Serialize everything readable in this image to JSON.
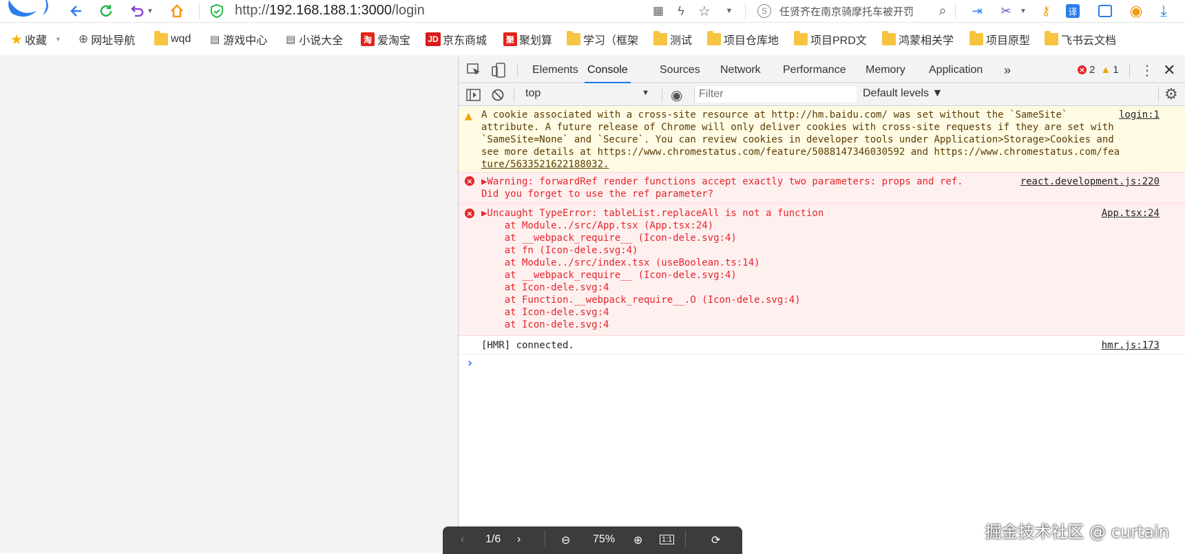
{
  "browser": {
    "url_prefix": "http://",
    "url_host": "192.168.188.1:3000",
    "url_path": "/login",
    "search_placeholder": "任贤齐在南京骑摩托车被开罚",
    "nav_icons": [
      "logo-icon",
      "back-icon",
      "refresh-icon",
      "undo-icon",
      "home-icon"
    ]
  },
  "bookmarks": [
    {
      "label": "收藏",
      "icon": "star"
    },
    {
      "label": "网址导航",
      "icon": "globe"
    },
    {
      "label": "wqd",
      "icon": "folder"
    },
    {
      "label": "游戏中心",
      "icon": "doc"
    },
    {
      "label": "小说大全",
      "icon": "doc"
    },
    {
      "label": "爱淘宝",
      "icon": "taobao",
      "badge": "淘"
    },
    {
      "label": "京东商城",
      "icon": "jd",
      "badge": "JD"
    },
    {
      "label": "聚划算",
      "icon": "jhs",
      "badge": "聚"
    },
    {
      "label": "学习（框架",
      "icon": "folder"
    },
    {
      "label": "测试",
      "icon": "folder"
    },
    {
      "label": "项目仓库地",
      "icon": "folder"
    },
    {
      "label": "项目PRD文",
      "icon": "folder"
    },
    {
      "label": "鸿蒙相关学",
      "icon": "folder"
    },
    {
      "label": "项目原型",
      "icon": "folder"
    },
    {
      "label": "飞书云文档",
      "icon": "folder"
    }
  ],
  "devtools": {
    "tabs": [
      "Elements",
      "Console",
      "Sources",
      "Network",
      "Performance",
      "Memory",
      "Application"
    ],
    "more_tabs": "»",
    "error_count": "2",
    "warning_count": "1",
    "context": "top",
    "filter_placeholder": "Filter",
    "levels": "Default levels ▼"
  },
  "console": {
    "warning": {
      "lines": [
        "A cookie associated with a cross-site resource at http://hm.baidu.com/ was set without the `SameSite`",
        "attribute. A future release of Chrome will only deliver cookies with cross-site requests if they are set with",
        "`SameSite=None` and `Secure`. You can review cookies in developer tools under Application>Storage>Cookies and",
        "see more details at https://www.chromestatus.com/feature/5088147346030592 and https://www.chromestatus.com/fea",
        "ture/5633521622188032."
      ],
      "source": "login:1"
    },
    "error1": {
      "lines": [
        "▶Warning: forwardRef render functions accept exactly two parameters: props and ref.",
        "Did you forget to use the ref parameter?"
      ],
      "source": "react.development.js:220"
    },
    "error2": {
      "lines": [
        "▶Uncaught TypeError: tableList.replaceAll is not a function",
        "    at Module../src/App.tsx (App.tsx:24)",
        "    at __webpack_require__ (Icon-dele.svg:4)",
        "    at fn (Icon-dele.svg:4)",
        "    at Module../src/index.tsx (useBoolean.ts:14)",
        "    at __webpack_require__ (Icon-dele.svg:4)",
        "    at Icon-dele.svg:4",
        "    at Function.__webpack_require__.O (Icon-dele.svg:4)",
        "    at Icon-dele.svg:4",
        "    at Icon-dele.svg:4"
      ],
      "source": "App.tsx:24"
    },
    "info": {
      "text": "[HMR] connected.",
      "source": "hmr.js:173"
    },
    "prompt": "›"
  },
  "viewer": {
    "page": "1/6",
    "zoom": "75%",
    "ratio": "1:1"
  },
  "watermark_tag": "掘金技术社区 @ curtain",
  "colors": {
    "accent": "#1a73e8",
    "error": "#e4262b",
    "warning_bg": "#fffbe5",
    "error_bg": "#fff0f0"
  }
}
